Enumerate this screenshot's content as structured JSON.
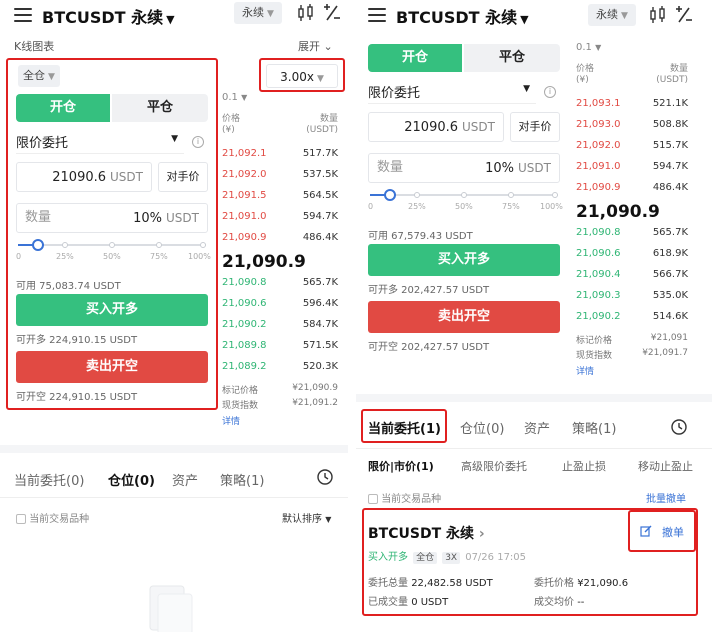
{
  "left": {
    "symbol": "BTCUSDT 永续",
    "contract_type": "永续",
    "kline_label": "K线图表",
    "expand_label": "展开",
    "margin_mode": "全仓",
    "leverage": "3.00x",
    "tab_open": "开仓",
    "tab_close": "平仓",
    "order_type": "限价委托",
    "price_value": "21090.6",
    "price_unit": "USDT",
    "counter_price_label": "对手价",
    "qty_placeholder": "数量",
    "qty_percent": "10%",
    "qty_unit": "USDT",
    "slider_marks": [
      "0",
      "25%",
      "50%",
      "75%",
      "100%"
    ],
    "slider_value": 0.1,
    "available": "可用 75,083.74 USDT",
    "buy_label": "买入开多",
    "can_open_long": "可开多 224,910.15 USDT",
    "sell_label": "卖出开空",
    "can_open_short": "可开空 224,910.15 USDT",
    "orderbook": {
      "precision": "0.1",
      "price_head": "价格",
      "price_unit": "(¥)",
      "qty_head": "数量",
      "qty_unit": "(USDT)",
      "asks": [
        {
          "price": "21,092.1",
          "qty": "517.7K"
        },
        {
          "price": "21,092.0",
          "qty": "537.5K"
        },
        {
          "price": "21,091.5",
          "qty": "564.5K"
        },
        {
          "price": "21,091.0",
          "qty": "594.7K"
        },
        {
          "price": "21,090.9",
          "qty": "486.4K"
        }
      ],
      "last_price": "21,090.9",
      "bids": [
        {
          "price": "21,090.8",
          "qty": "565.7K"
        },
        {
          "price": "21,090.6",
          "qty": "596.4K"
        },
        {
          "price": "21,090.2",
          "qty": "584.7K"
        },
        {
          "price": "21,089.8",
          "qty": "571.5K"
        },
        {
          "price": "21,089.2",
          "qty": "520.3K"
        }
      ],
      "mark_label": "标记价格",
      "mark_value": "¥21,090.9",
      "index_label": "现货指数",
      "index_value": "¥21,091.2",
      "details": "详情"
    },
    "tabs": [
      "当前委托(0)",
      "仓位(0)",
      "资产",
      "策略(1)"
    ],
    "current_symbol_only": "当前交易品种",
    "sort_label": "默认排序"
  },
  "right": {
    "symbol": "BTCUSDT 永续",
    "contract_type": "永续",
    "tab_open": "开仓",
    "tab_close": "平仓",
    "order_type": "限价委托",
    "price_value": "21090.6",
    "price_unit": "USDT",
    "counter_price_label": "对手价",
    "qty_placeholder": "数量",
    "qty_percent": "10%",
    "qty_unit": "USDT",
    "slider_marks": [
      "0",
      "25%",
      "50%",
      "75%",
      "100%"
    ],
    "available": "可用 67,579.43 USDT",
    "buy_label": "买入开多",
    "can_open_long": "可开多 202,427.57 USDT",
    "sell_label": "卖出开空",
    "can_open_short": "可开空 202,427.57 USDT",
    "orderbook": {
      "precision": "0.1",
      "price_head": "价格",
      "price_unit": "(¥)",
      "qty_head": "数量",
      "qty_unit": "(USDT)",
      "asks": [
        {
          "price": "21,093.1",
          "qty": "521.1K"
        },
        {
          "price": "21,093.0",
          "qty": "508.8K"
        },
        {
          "price": "21,092.0",
          "qty": "515.7K"
        },
        {
          "price": "21,091.0",
          "qty": "594.7K"
        },
        {
          "price": "21,090.9",
          "qty": "486.4K"
        }
      ],
      "last_price": "21,090.9",
      "bids": [
        {
          "price": "21,090.8",
          "qty": "565.7K"
        },
        {
          "price": "21,090.6",
          "qty": "618.9K"
        },
        {
          "price": "21,090.4",
          "qty": "566.7K"
        },
        {
          "price": "21,090.3",
          "qty": "535.0K"
        },
        {
          "price": "21,090.2",
          "qty": "514.6K"
        }
      ],
      "mark_label": "标记价格",
      "mark_value": "¥21,091",
      "index_label": "现货指数",
      "index_value": "¥21,091.7",
      "details": "详情"
    },
    "tabs": [
      "当前委托(1)",
      "仓位(0)",
      "资产",
      "策略(1)"
    ],
    "sub_tabs": [
      "限价|市价(1)",
      "高级限价委托",
      "止盈止损",
      "移动止盈止"
    ],
    "current_symbol_only": "当前交易品种",
    "batch_cancel": "批量撤单",
    "order": {
      "title": "BTCUSDT 永续",
      "side": "买入开多",
      "margin": "全仓",
      "leverage": "3X",
      "time": "07/26 17:05",
      "amount_label": "委托总量",
      "amount_value": "22,482.58 USDT",
      "price_label": "委托价格",
      "price_value": "¥21,090.6",
      "filled_label": "已成交量",
      "filled_value": "0 USDT",
      "avg_label": "成交均价",
      "avg_value": "--",
      "cancel_label": "撤单"
    }
  },
  "colors": {
    "green": "#35c07f",
    "red": "#e14a43",
    "highlight": "#e02020",
    "link": "#3a73d6"
  }
}
